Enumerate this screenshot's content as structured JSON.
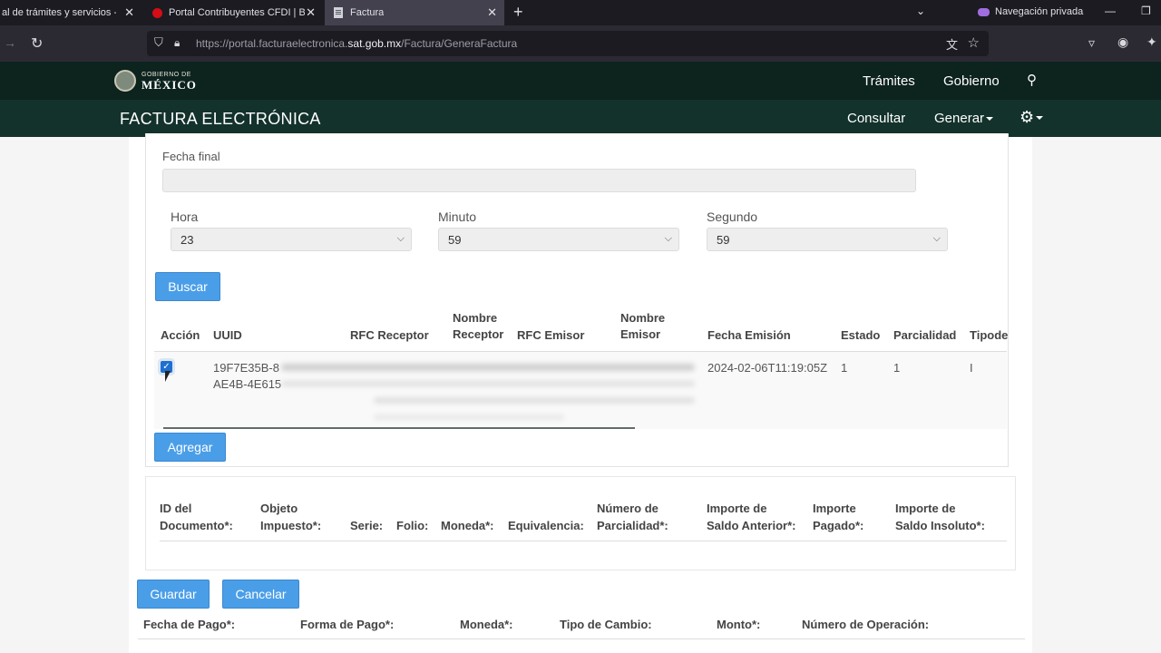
{
  "browser": {
    "tabs": [
      {
        "title": "al de trámites y servicios -"
      },
      {
        "title": "Portal Contribuyentes CFDI | Bu"
      },
      {
        "title": "Factura"
      }
    ],
    "private_label": "Navegación privada",
    "url_prefix": "https://portal.facturaelectronica.",
    "url_domain": "sat.gob.mx",
    "url_path": "/Factura/GeneraFactura"
  },
  "site": {
    "logo_small": "GOBIERNO DE",
    "logo_big": "MÉXICO",
    "nav": [
      "Trámites",
      "Gobierno"
    ],
    "subtitle": "FACTURA ELECTRÓNICA",
    "subnav": [
      "Consultar",
      "Generar"
    ]
  },
  "search_form": {
    "fecha_final_label": "Fecha final",
    "fecha_final_value": "",
    "hora_label": "Hora",
    "hora_value": "23",
    "minuto_label": "Minuto",
    "minuto_value": "59",
    "segundo_label": "Segundo",
    "segundo_value": "59",
    "buscar_label": "Buscar"
  },
  "results": {
    "headers": {
      "accion": "Acción",
      "uuid": "UUID",
      "rfc_receptor": "RFC Receptor",
      "nombre_receptor": [
        "Nombre",
        "Receptor"
      ],
      "rfc_emisor": "RFC Emisor",
      "nombre_emisor": [
        "Nombre",
        "Emisor"
      ],
      "fecha_emision": "Fecha Emisión",
      "estado": "Estado",
      "parcialidad": "Parcialidad",
      "tipo": "Tipode"
    },
    "row": {
      "checked": true,
      "uuid_line1": "19F7E35B-8",
      "uuid_line2": "AE4B-4E615",
      "fecha_emision": "2024-02-06T11:19:05Z",
      "estado": "1",
      "parcialidad": "1",
      "tipo": "I"
    },
    "agregar_label": "Agregar"
  },
  "documents": {
    "headers": [
      [
        "ID del",
        "Documento*:"
      ],
      [
        "Objeto",
        "Impuesto*:"
      ],
      [
        "",
        "Serie:"
      ],
      [
        "",
        "Folio:"
      ],
      [
        "",
        "Moneda*:"
      ],
      [
        "",
        "Equivalencia:"
      ],
      [
        "Número de",
        "Parcialidad*:"
      ],
      [
        "Importe de",
        "Saldo Anterior*:"
      ],
      [
        "Importe",
        "Pagado*:"
      ],
      [
        "Importe de",
        "Saldo Insoluto*:"
      ]
    ],
    "guardar_label": "Guardar",
    "cancelar_label": "Cancelar"
  },
  "payments": {
    "headers": [
      "Fecha de Pago*:",
      "Forma de Pago*:",
      "Moneda*:",
      "Tipo de Cambio:",
      "Monto*:",
      "Número de Operación:"
    ]
  },
  "colors": {
    "header_dark": "#0c231e",
    "header_green": "#13322b",
    "button_blue": "#4a9ee8"
  }
}
